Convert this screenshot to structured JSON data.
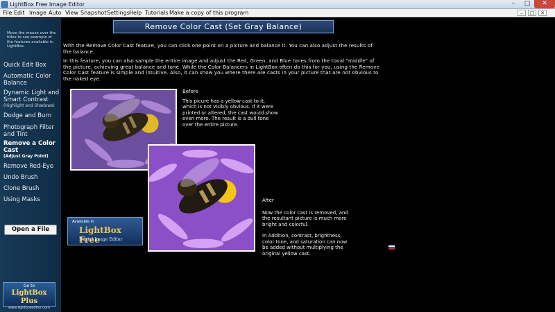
{
  "window": {
    "title": "LightBox Free Image Editor",
    "min_glyph": "–",
    "max_glyph": "□",
    "close_glyph": "✕"
  },
  "menu": {
    "items": [
      "File",
      "Edit",
      "Image",
      "Auto",
      "View",
      "Snapshot",
      "Settings",
      "Help",
      "Tutorials",
      "Make a copy of this program"
    ]
  },
  "sidebar": {
    "hint": "Move the mouse over the titles to see example of the features available in LightBox.",
    "items": [
      {
        "label": "Quick Edit Box",
        "sub": ""
      },
      {
        "label": "Automatic Color Balance",
        "sub": ""
      },
      {
        "label": "Dynamic Light and Smart Contrast",
        "sub": "(Highlight and Shadows)"
      },
      {
        "label": "Dodge and Burn",
        "sub": ""
      },
      {
        "label": "Photograph Filter and Tint",
        "sub": ""
      },
      {
        "label": "Remove a Color Cast",
        "sub": "(Adjust Gray Point)"
      },
      {
        "label": "Remove Red-Eye",
        "sub": ""
      },
      {
        "label": "Undo Brush",
        "sub": ""
      },
      {
        "label": "Clone Brush",
        "sub": ""
      },
      {
        "label": "Using Masks",
        "sub": ""
      }
    ],
    "open_file": "Open a File",
    "plus_badge": {
      "goto": "Go to",
      "name": "LightBox Plus",
      "url": "www.lightboxeditor.com"
    }
  },
  "content": {
    "heading": "Remove Color Cast (Set Gray Balance)",
    "para1": "With the Remove Color Cast feature, you can click one point on a picture and balance it.  You can also adjust the results of the balance.",
    "para2": "In this feature, you can also sample the entire image and adjust the Red, Green, and Blue tones from the tonal \"middle\" of the picture, achieving great balance and tone.  While the Color Balancers in LightBox often do this for you, using the Remove Color Cast feature is simple and intuitive.  Also, it can show you where there are casts in your picture that are not obvious to the naked eye.",
    "before_title": "Before",
    "before_text": "This picure has a yellow cast to it, which is not visibly obvious. If  it were printed or altered, the cast would show even more. The result is a dull tone over the entire picture.",
    "after_title": "After",
    "after_text1": "Now the color cast is removed, and the resultant picture is much more bright and colorful.",
    "after_text2": "In Addition, contrast, brightness, color tone, and saturation can now be added without multiplying the original yellow cast.",
    "free_badge": {
      "available": "Available in",
      "name": "LightBox Free",
      "tagline": "Digital Image Editor"
    }
  },
  "icons": {
    "app": "lightbox-app-icon",
    "flag": "russian-flag-icon"
  },
  "colors": {
    "sidebar_bg": "#173a57",
    "heading_bg": "#2c4a78",
    "accent_badge": "#f0c45a"
  }
}
